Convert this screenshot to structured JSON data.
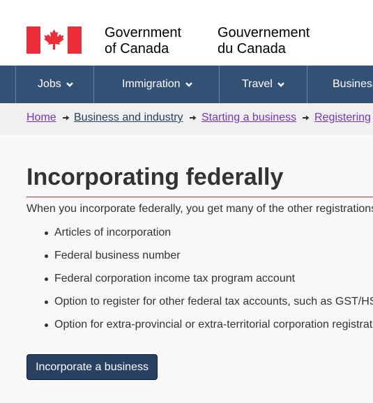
{
  "header": {
    "gov_en_line1": "Government",
    "gov_en_line2": "of Canada",
    "gov_fr_line1": "Gouvernement",
    "gov_fr_line2": "du Canada"
  },
  "nav": {
    "items": [
      {
        "label": "Jobs"
      },
      {
        "label": "Immigration"
      },
      {
        "label": "Travel"
      },
      {
        "label": "Business"
      }
    ]
  },
  "breadcrumb": {
    "items": [
      {
        "label": "Home"
      },
      {
        "label": "Business and industry"
      },
      {
        "label": "Starting a business"
      },
      {
        "label": "Registering"
      }
    ]
  },
  "main": {
    "title": "Incorporating federally",
    "intro": "When you incorporate federally, you get many of the other registrations",
    "list": [
      "Articles of incorporation",
      "Federal business number",
      "Federal corporation income tax program account",
      "Option to register for other federal tax accounts, such as GST/HS",
      "Option for extra-provincial or extra-territorial corporation registrat"
    ],
    "cta_label": "Incorporate a business"
  },
  "colors": {
    "nav_bg": "#335075",
    "flag_red": "#eb2d37",
    "title_rule": "#af3c43",
    "button_bg": "#284162",
    "visited_link": "#7834bc"
  }
}
